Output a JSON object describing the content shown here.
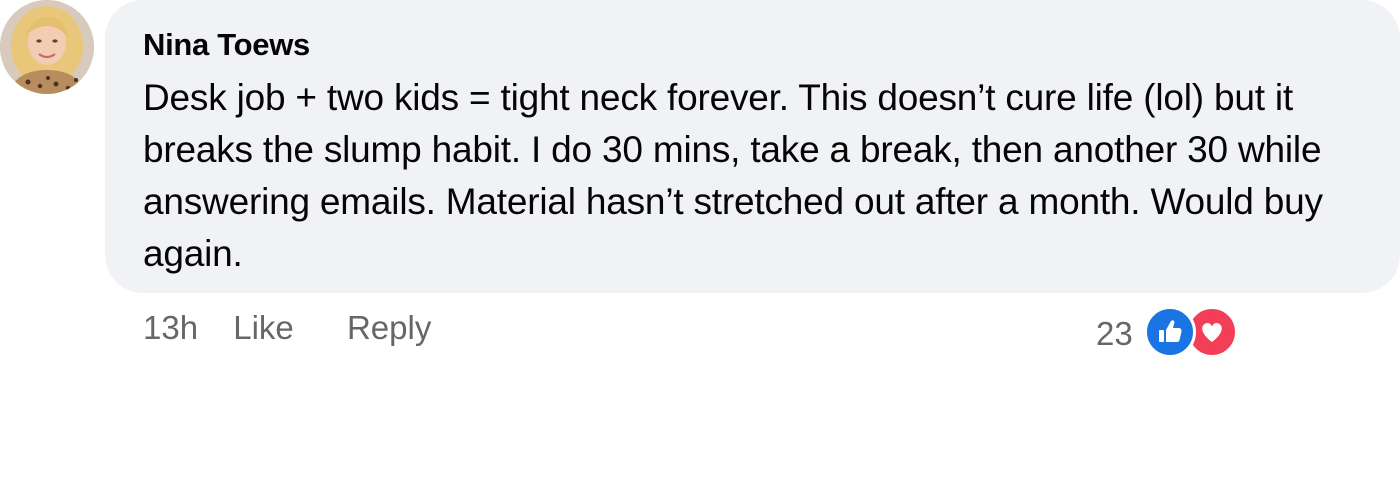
{
  "comment": {
    "author": "Nina Toews",
    "text": "Desk job + two kids = tight neck forever. This doesn’t cure life (lol) but it breaks the slump habit. I do 30 mins, take a break, then another 30 while answering emails. Material hasn’t stretched out after a month. Would buy again.",
    "timestamp": "13h",
    "like_label": "Like",
    "reply_label": "Reply",
    "reaction_count": "23",
    "reaction_icons": [
      "like-icon",
      "love-icon"
    ]
  },
  "colors": {
    "bubble_bg": "#f0f2f5",
    "meta_text": "#65676b",
    "like_blue": "#1b74e4",
    "love_red": "#f33e58"
  }
}
